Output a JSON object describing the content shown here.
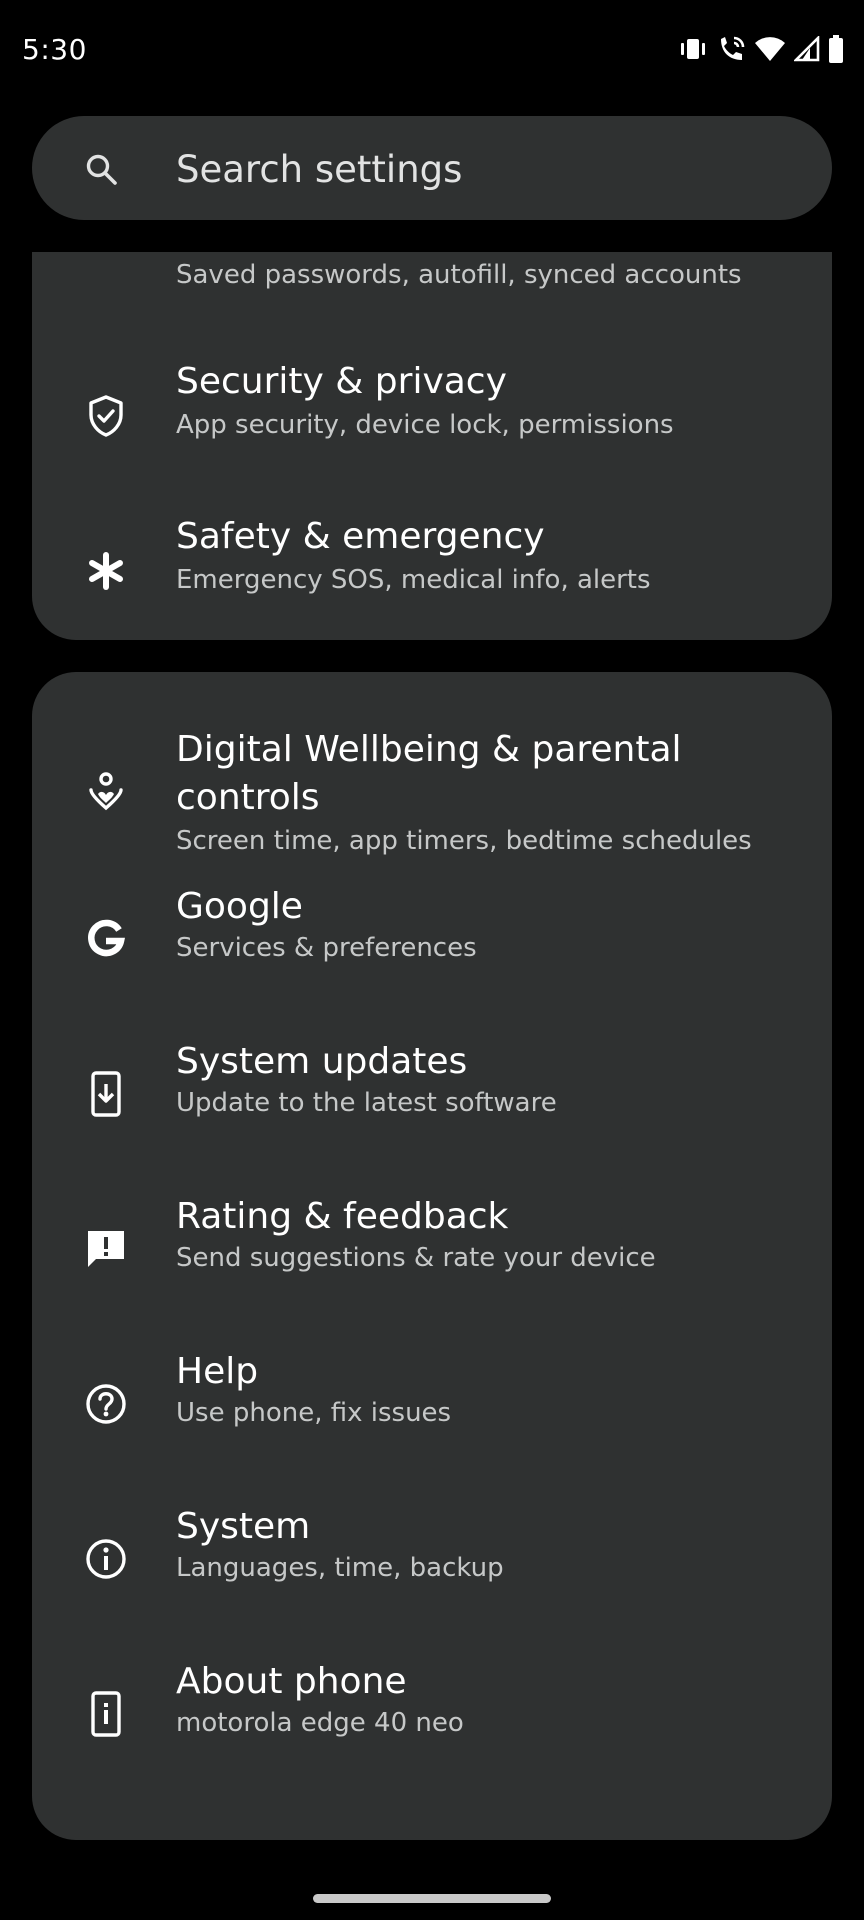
{
  "status_bar": {
    "time": "5:30",
    "icons": [
      "vibrate-icon",
      "wifi-calling-icon",
      "wifi-icon",
      "signal-icon",
      "battery-icon"
    ]
  },
  "search": {
    "placeholder": "Search settings",
    "icon": "search-icon"
  },
  "top_card": {
    "items": [
      {
        "subtitle": "Saved passwords, autofill, synced accounts",
        "icon": "passwords-icon"
      },
      {
        "title": "Security & privacy",
        "subtitle": "App security, device lock, permissions",
        "icon": "shield-icon"
      },
      {
        "title": "Safety & emergency",
        "subtitle": "Emergency SOS, medical info, alerts",
        "icon": "asterisk-icon"
      }
    ]
  },
  "main_card": {
    "items": [
      {
        "title": "Digital Wellbeing & parental controls",
        "subtitle": "Screen time, app timers, bedtime schedules",
        "icon": "wellbeing-icon"
      },
      {
        "title": "Google",
        "subtitle": "Services & preferences",
        "icon": "google-icon"
      },
      {
        "title": "System updates",
        "subtitle": "Update to the latest software",
        "icon": "system-update-icon"
      },
      {
        "title": "Rating & feedback",
        "subtitle": "Send suggestions & rate your device",
        "icon": "feedback-icon"
      },
      {
        "title": "Help",
        "subtitle": "Use phone, fix issues",
        "icon": "help-icon"
      },
      {
        "title": "System",
        "subtitle": "Languages, time, backup",
        "icon": "info-icon"
      },
      {
        "title": "About phone",
        "subtitle": "motorola edge 40 neo",
        "icon": "phone-info-icon"
      }
    ]
  },
  "colors": {
    "background": "#000000",
    "card": "#2f3131",
    "text_primary": "#ffffff",
    "text_secondary": "#c6c8c8"
  }
}
